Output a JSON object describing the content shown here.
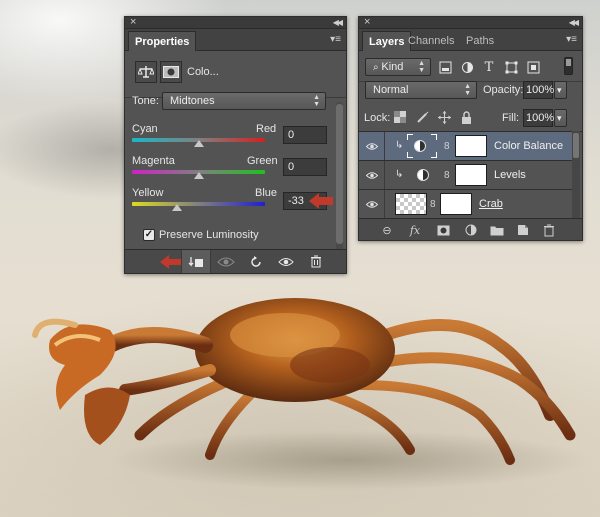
{
  "properties_panel": {
    "tab_label": "Properties",
    "title": "Colo...",
    "tone_label": "Tone:",
    "tone_value": "Midtones",
    "sliders": [
      {
        "left": "Cyan",
        "right": "Red",
        "value": "0",
        "position": 0.5
      },
      {
        "left": "Magenta",
        "right": "Green",
        "value": "0",
        "position": 0.5
      },
      {
        "left": "Yellow",
        "right": "Blue",
        "value": "-33",
        "position": 0.34
      }
    ],
    "preserve_luminosity_label": "Preserve Luminosity",
    "preserve_luminosity_checked": true
  },
  "layers_panel": {
    "tabs": [
      "Layers",
      "Channels",
      "Paths"
    ],
    "filter_value": "Kind",
    "blend_mode": "Normal",
    "opacity_label": "Opacity:",
    "opacity_value": "100%",
    "lock_label": "Lock:",
    "fill_label": "Fill:",
    "fill_value": "100%",
    "layers": [
      {
        "name": "Color Balance",
        "selected": true
      },
      {
        "name": "Levels",
        "selected": false
      },
      {
        "name": "Crab",
        "selected": false
      }
    ]
  },
  "colors": {
    "panel_bg": "#535353",
    "selected_layer": "#5e6a7e",
    "annotation_arrow": "#c0392b"
  }
}
